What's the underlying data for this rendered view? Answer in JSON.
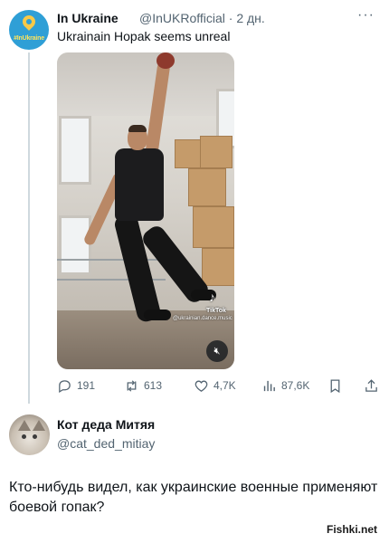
{
  "tweet": {
    "author_name": "In Ukraine",
    "author_handle": "@InUKRofficial",
    "separator_time": "· 2 дн.",
    "more_label": "···",
    "avatar_text": "#InUkraine",
    "text": "Ukrainain Hopak seems unreal",
    "media": {
      "watermark_brand": "TikTok",
      "watermark_user": "@ukrainian.dance.music",
      "mute_icon": "volume-off-icon"
    },
    "actions": {
      "replies": "191",
      "retweets": "613",
      "likes": "4,7K",
      "views": "87,6K"
    }
  },
  "reply": {
    "author_name": "Кот деда Митяя",
    "author_handle": "@cat_ded_mitiay",
    "text": "Кто-нибудь видел, как украинские военные применяют боевой гопак?"
  },
  "site_watermark": "Fishki.net",
  "colors": {
    "text_primary": "#0f1419",
    "text_secondary": "#536471",
    "avatar_blue": "#2f9fd6",
    "avatar_yellow": "#f7c948"
  }
}
